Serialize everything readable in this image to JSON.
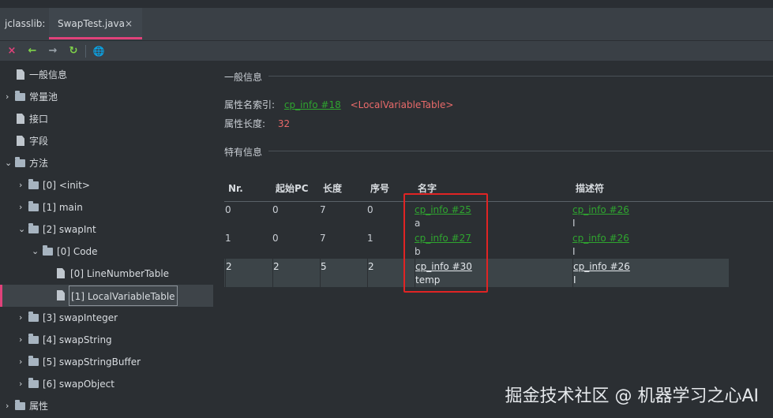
{
  "tabs": [
    {
      "label": "jclasslib:"
    },
    {
      "label": "SwapTest.java",
      "close": "×"
    }
  ],
  "toolbar": {
    "close_icon": "×",
    "back_icon": "←",
    "forward_icon": "→",
    "refresh_icon": "↻",
    "web_icon": "🌐",
    "colors": {
      "close": "#e0427a",
      "nav": "#7fd34a",
      "web": "#4aa0e0"
    }
  },
  "tree": {
    "items": [
      {
        "label": "一般信息"
      },
      {
        "label": "常量池"
      },
      {
        "label": "接口"
      },
      {
        "label": "字段"
      },
      {
        "label": "方法"
      },
      {
        "label": "[0] <init>"
      },
      {
        "label": "[1] main"
      },
      {
        "label": "[2] swapInt"
      },
      {
        "label": "[0] Code"
      },
      {
        "label": "[0] LineNumberTable"
      },
      {
        "label": "[1] LocalVariableTable"
      },
      {
        "label": "[3] swapInteger"
      },
      {
        "label": "[4] swapString"
      },
      {
        "label": "[5] swapStringBuffer"
      },
      {
        "label": "[6] swapObject"
      },
      {
        "label": "属性"
      }
    ]
  },
  "general": {
    "title": "一般信息",
    "name_index_label": "属性名索引:",
    "name_index_link": "cp_info #18",
    "name_index_value": "<LocalVariableTable>",
    "length_label": "属性长度:",
    "length_value": "32"
  },
  "specific": {
    "title": "特有信息",
    "columns": [
      "Nr.",
      "起始PC",
      "长度",
      "序号",
      "名字",
      "描述符"
    ],
    "rows": [
      {
        "nr": "0",
        "start_pc": "0",
        "length": "7",
        "index": "0",
        "name_link": "cp_info #25",
        "name": "a",
        "desc_link": "cp_info #26",
        "desc": "I"
      },
      {
        "nr": "1",
        "start_pc": "0",
        "length": "7",
        "index": "1",
        "name_link": "cp_info #27",
        "name": "b",
        "desc_link": "cp_info #26",
        "desc": "I"
      },
      {
        "nr": "2",
        "start_pc": "2",
        "length": "5",
        "index": "2",
        "name_link": "cp_info #30",
        "name": "temp",
        "desc_link": "cp_info #26",
        "desc": "I"
      }
    ]
  },
  "watermark": "掘金技术社区 @ 机器学习之心AI"
}
